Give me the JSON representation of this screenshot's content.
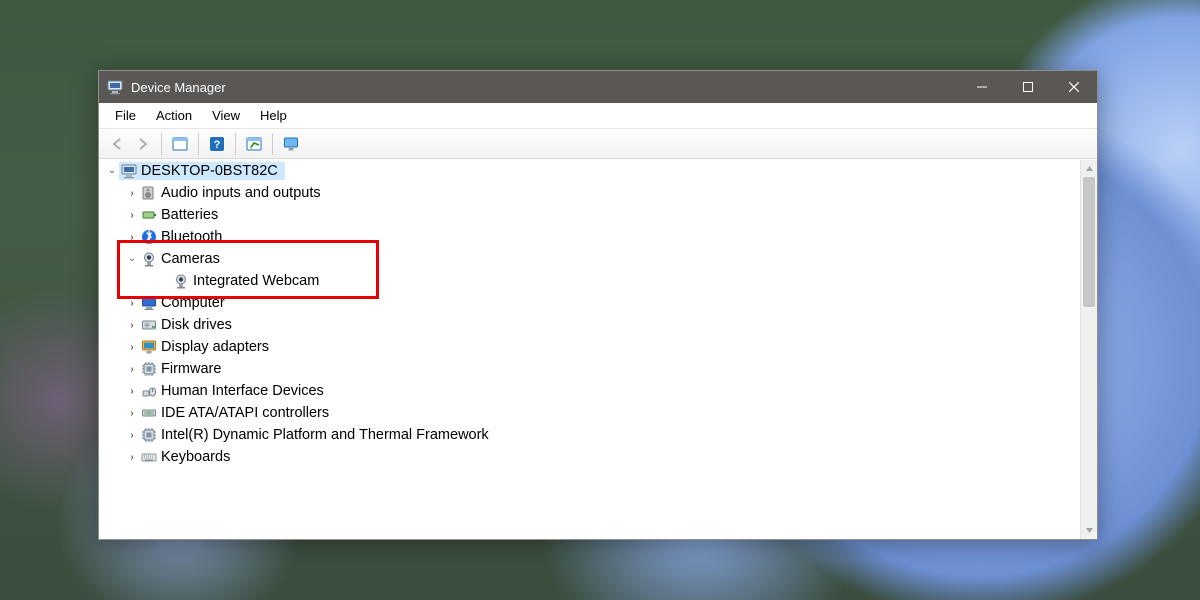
{
  "window": {
    "title": "Device Manager"
  },
  "menu": {
    "file": "File",
    "action": "Action",
    "view": "View",
    "help": "Help"
  },
  "toolbar_icons": {
    "back": "back-arrow-icon",
    "forward": "forward-arrow-icon",
    "show_hidden": "show-hidden-devices-icon",
    "help": "help-icon",
    "scan": "scan-hardware-icon",
    "monitor": "monitor-icon"
  },
  "tree": {
    "root": "DESKTOP-0BST82C",
    "items": [
      {
        "label": "Audio inputs and outputs"
      },
      {
        "label": "Batteries"
      },
      {
        "label": "Bluetooth"
      },
      {
        "label": "Cameras",
        "expanded": true,
        "children": [
          {
            "label": "Integrated Webcam"
          }
        ]
      },
      {
        "label": "Computer"
      },
      {
        "label": "Disk drives"
      },
      {
        "label": "Display adapters"
      },
      {
        "label": "Firmware"
      },
      {
        "label": "Human Interface Devices"
      },
      {
        "label": "IDE ATA/ATAPI controllers"
      },
      {
        "label": "Intel(R) Dynamic Platform and Thermal Framework"
      },
      {
        "label": "Keyboards"
      }
    ]
  }
}
